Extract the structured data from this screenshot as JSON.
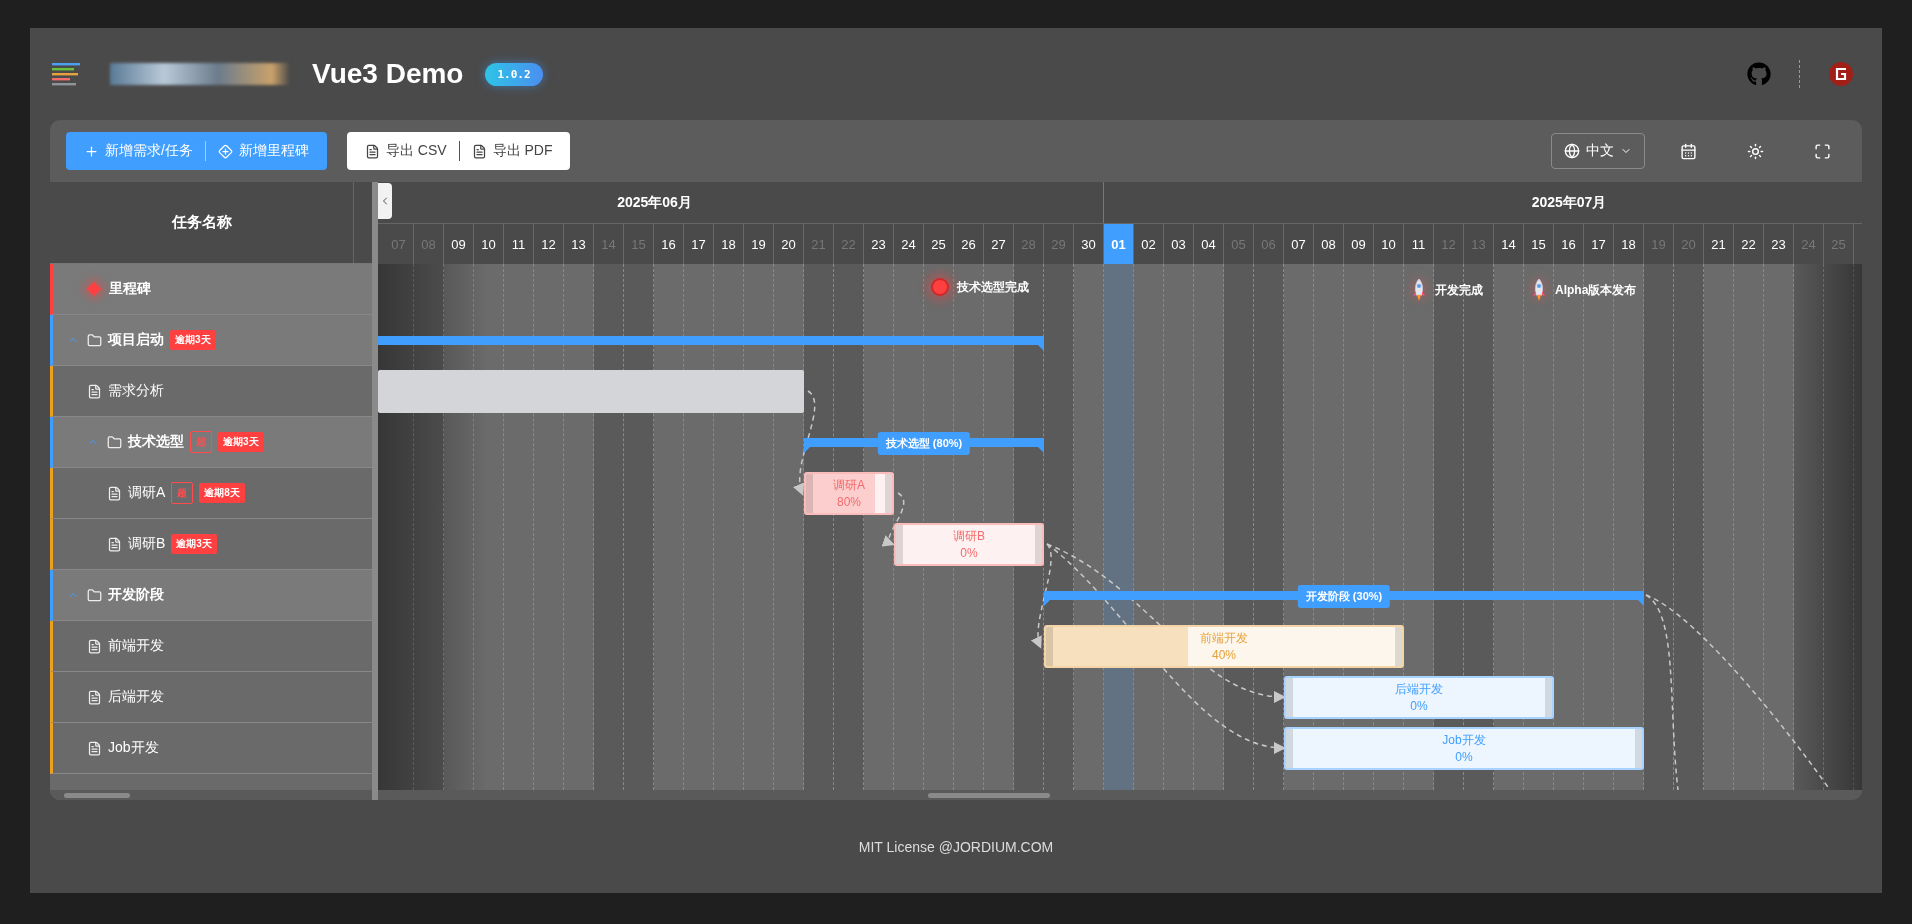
{
  "header": {
    "title": "Vue3 Demo",
    "version": "1.0.2"
  },
  "toolbar": {
    "create_buttons": [
      "新增需求/任务",
      "新增里程碑"
    ],
    "export_buttons": [
      "导出 CSV",
      "导出 PDF"
    ],
    "language": "中文"
  },
  "task_list": {
    "column_title": "任务名称",
    "rows": [
      {
        "name": "里程碑",
        "kind": "milestone-group"
      },
      {
        "name": "项目启动",
        "kind": "group",
        "expanded": true,
        "tags": [
          {
            "text": "逾期3天",
            "kind": "overdue"
          }
        ],
        "bar": {},
        "children": [
          {
            "name": "需求分析",
            "kind": "task",
            "bar": {
              "level": 1,
              "color": "#d4d5d8"
            }
          },
          {
            "name": "技术选型",
            "kind": "group",
            "expanded": true,
            "tags": [
              {
                "text": "超",
                "kind": "outline"
              },
              {
                "text": "逾期3天",
                "kind": "overdue"
              }
            ],
            "bar": {
              "label": "技术选型 (80%)"
            },
            "children": [
              {
                "name": "调研A",
                "kind": "task",
                "tags": [
                  {
                    "text": "超",
                    "kind": "outline"
                  },
                  {
                    "text": "逾期8天",
                    "kind": "overdue"
                  }
                ],
                "bar": {
                  "label": "调研A",
                  "percent": "80%",
                  "level": 0.8,
                  "color": "#f56c6c"
                }
              },
              {
                "name": "调研B",
                "kind": "task",
                "tags": [
                  {
                    "text": "逾期3天",
                    "kind": "overdue"
                  }
                ],
                "bar": {
                  "label": "调研B",
                  "percent": "0%",
                  "color": "#f56c6c"
                }
              }
            ]
          }
        ]
      },
      {
        "name": "开发阶段",
        "kind": "group",
        "expanded": true,
        "bar": {
          "label": "开发阶段 (30%)"
        },
        "children": [
          {
            "name": "前端开发",
            "kind": "task",
            "bar": {
              "label": "前端开发",
              "percent": "40%",
              "level": 0.4,
              "color": "#e6a23c"
            }
          },
          {
            "name": "后端开发",
            "kind": "task",
            "bar": {
              "label": "后端开发",
              "percent": "0%",
              "color": "#409eff"
            }
          },
          {
            "name": "Job开发",
            "kind": "task",
            "bar": {
              "label": "Job开发",
              "percent": "0%",
              "color": "#409eff"
            }
          }
        ]
      }
    ]
  },
  "timeline": {
    "months": [
      "2025年06月",
      "2025年07月"
    ],
    "days": [
      {
        "label": "07",
        "weekend": true,
        "today": false
      },
      {
        "label": "08",
        "weekend": true,
        "today": false
      },
      {
        "label": "09",
        "weekend": false,
        "today": false
      },
      {
        "label": "10",
        "weekend": false,
        "today": false
      },
      {
        "label": "11",
        "weekend": false,
        "today": false
      },
      {
        "label": "12",
        "weekend": false,
        "today": false
      },
      {
        "label": "13",
        "weekend": false,
        "today": false
      },
      {
        "label": "14",
        "weekend": true,
        "today": false
      },
      {
        "label": "15",
        "weekend": true,
        "today": false
      },
      {
        "label": "16",
        "weekend": false,
        "today": false
      },
      {
        "label": "17",
        "weekend": false,
        "today": false
      },
      {
        "label": "18",
        "weekend": false,
        "today": false
      },
      {
        "label": "19",
        "weekend": false,
        "today": false
      },
      {
        "label": "20",
        "weekend": false,
        "today": false
      },
      {
        "label": "21",
        "weekend": true,
        "today": false
      },
      {
        "label": "22",
        "weekend": true,
        "today": false
      },
      {
        "label": "23",
        "weekend": false,
        "today": false
      },
      {
        "label": "24",
        "weekend": false,
        "today": false
      },
      {
        "label": "25",
        "weekend": false,
        "today": false
      },
      {
        "label": "26",
        "weekend": false,
        "today": false
      },
      {
        "label": "27",
        "weekend": false,
        "today": false
      },
      {
        "label": "28",
        "weekend": true,
        "today": false
      },
      {
        "label": "29",
        "weekend": true,
        "today": false
      },
      {
        "label": "30",
        "weekend": false,
        "today": false
      },
      {
        "label": "01",
        "weekend": false,
        "today": true
      },
      {
        "label": "02",
        "weekend": false,
        "today": false
      },
      {
        "label": "03",
        "weekend": false,
        "today": false
      },
      {
        "label": "04",
        "weekend": false,
        "today": false
      },
      {
        "label": "05",
        "weekend": true,
        "today": false
      },
      {
        "label": "06",
        "weekend": true,
        "today": false
      },
      {
        "label": "07",
        "weekend": false,
        "today": false
      },
      {
        "label": "08",
        "weekend": false,
        "today": false
      },
      {
        "label": "09",
        "weekend": false,
        "today": false
      },
      {
        "label": "10",
        "weekend": false,
        "today": false
      },
      {
        "label": "11",
        "weekend": false,
        "today": false
      },
      {
        "label": "12",
        "weekend": true,
        "today": false
      },
      {
        "label": "13",
        "weekend": true,
        "today": false
      },
      {
        "label": "14",
        "weekend": false,
        "today": false
      },
      {
        "label": "15",
        "weekend": false,
        "today": false
      },
      {
        "label": "16",
        "weekend": false,
        "today": false
      },
      {
        "label": "17",
        "weekend": false,
        "today": false
      },
      {
        "label": "18",
        "weekend": false,
        "today": false
      },
      {
        "label": "19",
        "weekend": true,
        "today": false
      },
      {
        "label": "20",
        "weekend": true,
        "today": false
      },
      {
        "label": "21",
        "weekend": false,
        "today": false
      },
      {
        "label": "22",
        "weekend": false,
        "today": false
      },
      {
        "label": "23",
        "weekend": false,
        "today": false
      },
      {
        "label": "24",
        "weekend": true,
        "today": false
      },
      {
        "label": "25",
        "weekend": true,
        "today": false
      }
    ]
  },
  "milestones": [
    {
      "label": "技术选型完成",
      "kind": "dot"
    },
    {
      "label": "开发完成",
      "kind": "rocket"
    },
    {
      "label": "Alpha版本发布",
      "kind": "rocket"
    }
  ],
  "footer": "MIT License @JORDIUM.COM"
}
